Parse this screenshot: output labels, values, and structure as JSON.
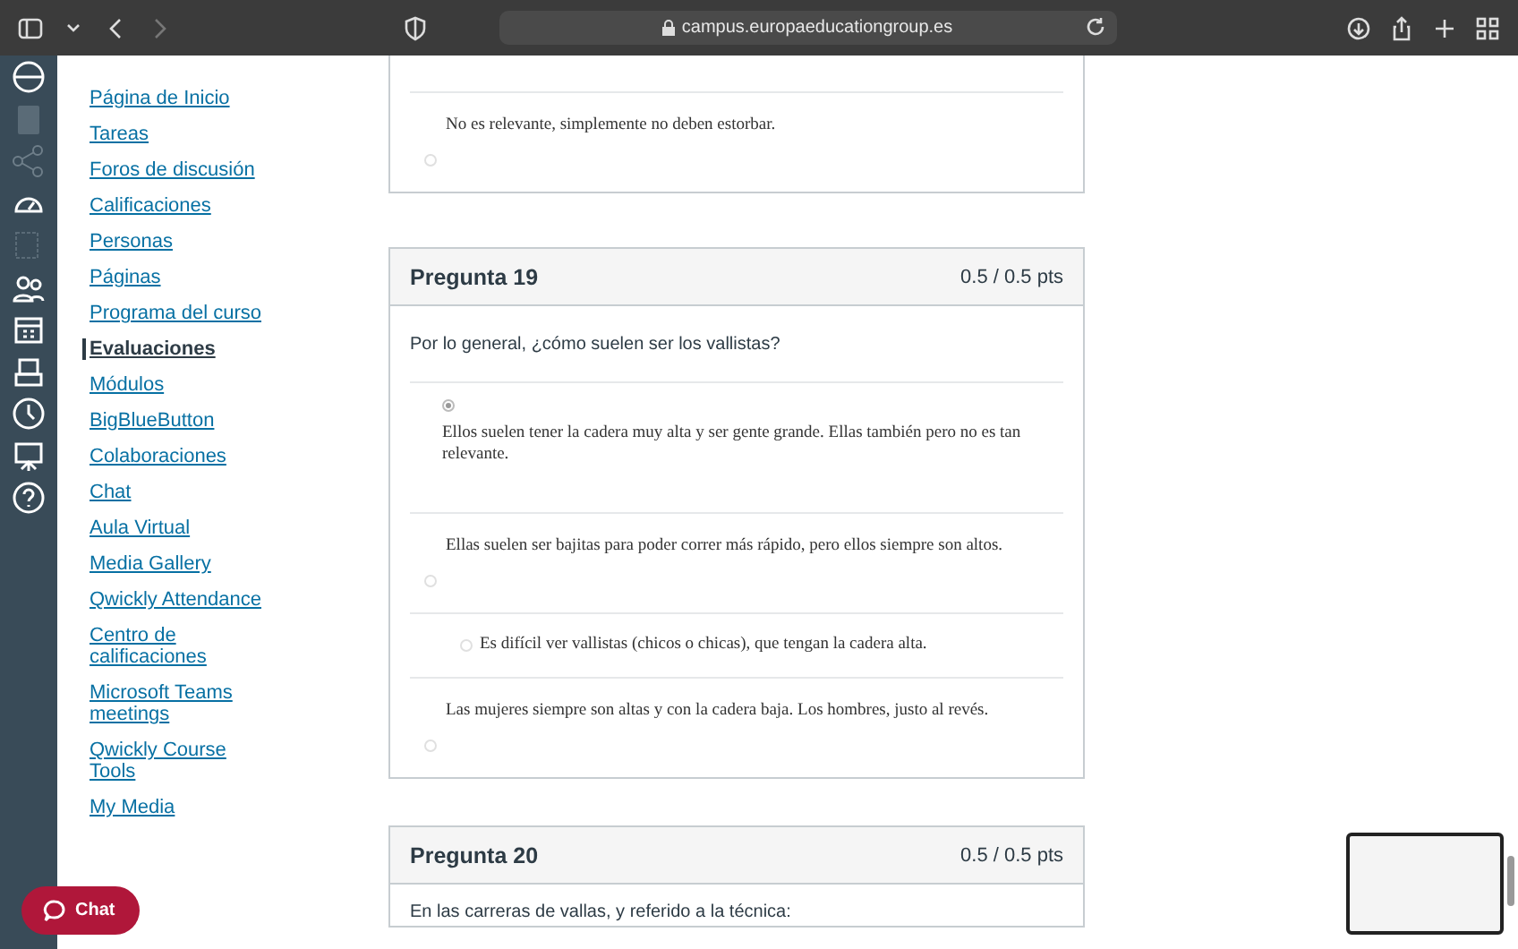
{
  "browser": {
    "url": "campus.europaeducationgroup.es"
  },
  "course_nav": [
    {
      "label": "Página de Inicio",
      "selected": false
    },
    {
      "label": "Tareas",
      "selected": false
    },
    {
      "label": "Foros de discusión",
      "selected": false
    },
    {
      "label": "Calificaciones",
      "selected": false
    },
    {
      "label": "Personas",
      "selected": false
    },
    {
      "label": "Páginas",
      "selected": false
    },
    {
      "label": "Programa del curso",
      "selected": false
    },
    {
      "label": "Evaluaciones",
      "selected": true
    },
    {
      "label": "Módulos",
      "selected": false
    },
    {
      "label": "BigBlueButton",
      "selected": false
    },
    {
      "label": "Colaboraciones",
      "selected": false
    },
    {
      "label": "Chat",
      "selected": false
    },
    {
      "label": "Aula Virtual",
      "selected": false
    },
    {
      "label": "Media Gallery",
      "selected": false
    },
    {
      "label": "Qwickly Attendance",
      "selected": false
    },
    {
      "label": "Centro de calificaciones",
      "selected": false
    },
    {
      "label": "Microsoft Teams meetings",
      "selected": false
    },
    {
      "label": "Qwickly Course Tools",
      "selected": false
    },
    {
      "label": "My Media",
      "selected": false
    }
  ],
  "questions": [
    {
      "answers": [
        {
          "text": "No es relevante, simplemente no deben estorbar.",
          "kind": "below",
          "selected": false
        }
      ]
    },
    {
      "title": "Pregunta 19",
      "points": "0.5 / 0.5 pts",
      "prompt": "Por lo general, ¿cómo suelen ser los vallistas?",
      "answers": [
        {
          "text": "Ellos suelen tener la cadera muy alta y ser gente grande. Ellas también pero no es tan relevante.",
          "kind": "above",
          "selected": true
        },
        {
          "text": "Ellas suelen ser bajitas para poder correr más rápido, pero ellos siempre son altos.",
          "kind": "below",
          "selected": false
        },
        {
          "text": "Es difícil ver vallistas (chicos o chicas), que tengan la cadera alta.",
          "kind": "inline",
          "selected": false
        },
        {
          "text": "Las mujeres siempre son altas y con la cadera baja. Los hombres, justo al revés.",
          "kind": "below",
          "selected": false
        }
      ]
    },
    {
      "title": "Pregunta 20",
      "points": "0.5 / 0.5 pts",
      "prompt": "En las carreras de vallas, y referido a la técnica:"
    }
  ],
  "chat_button": {
    "label": "Chat"
  }
}
